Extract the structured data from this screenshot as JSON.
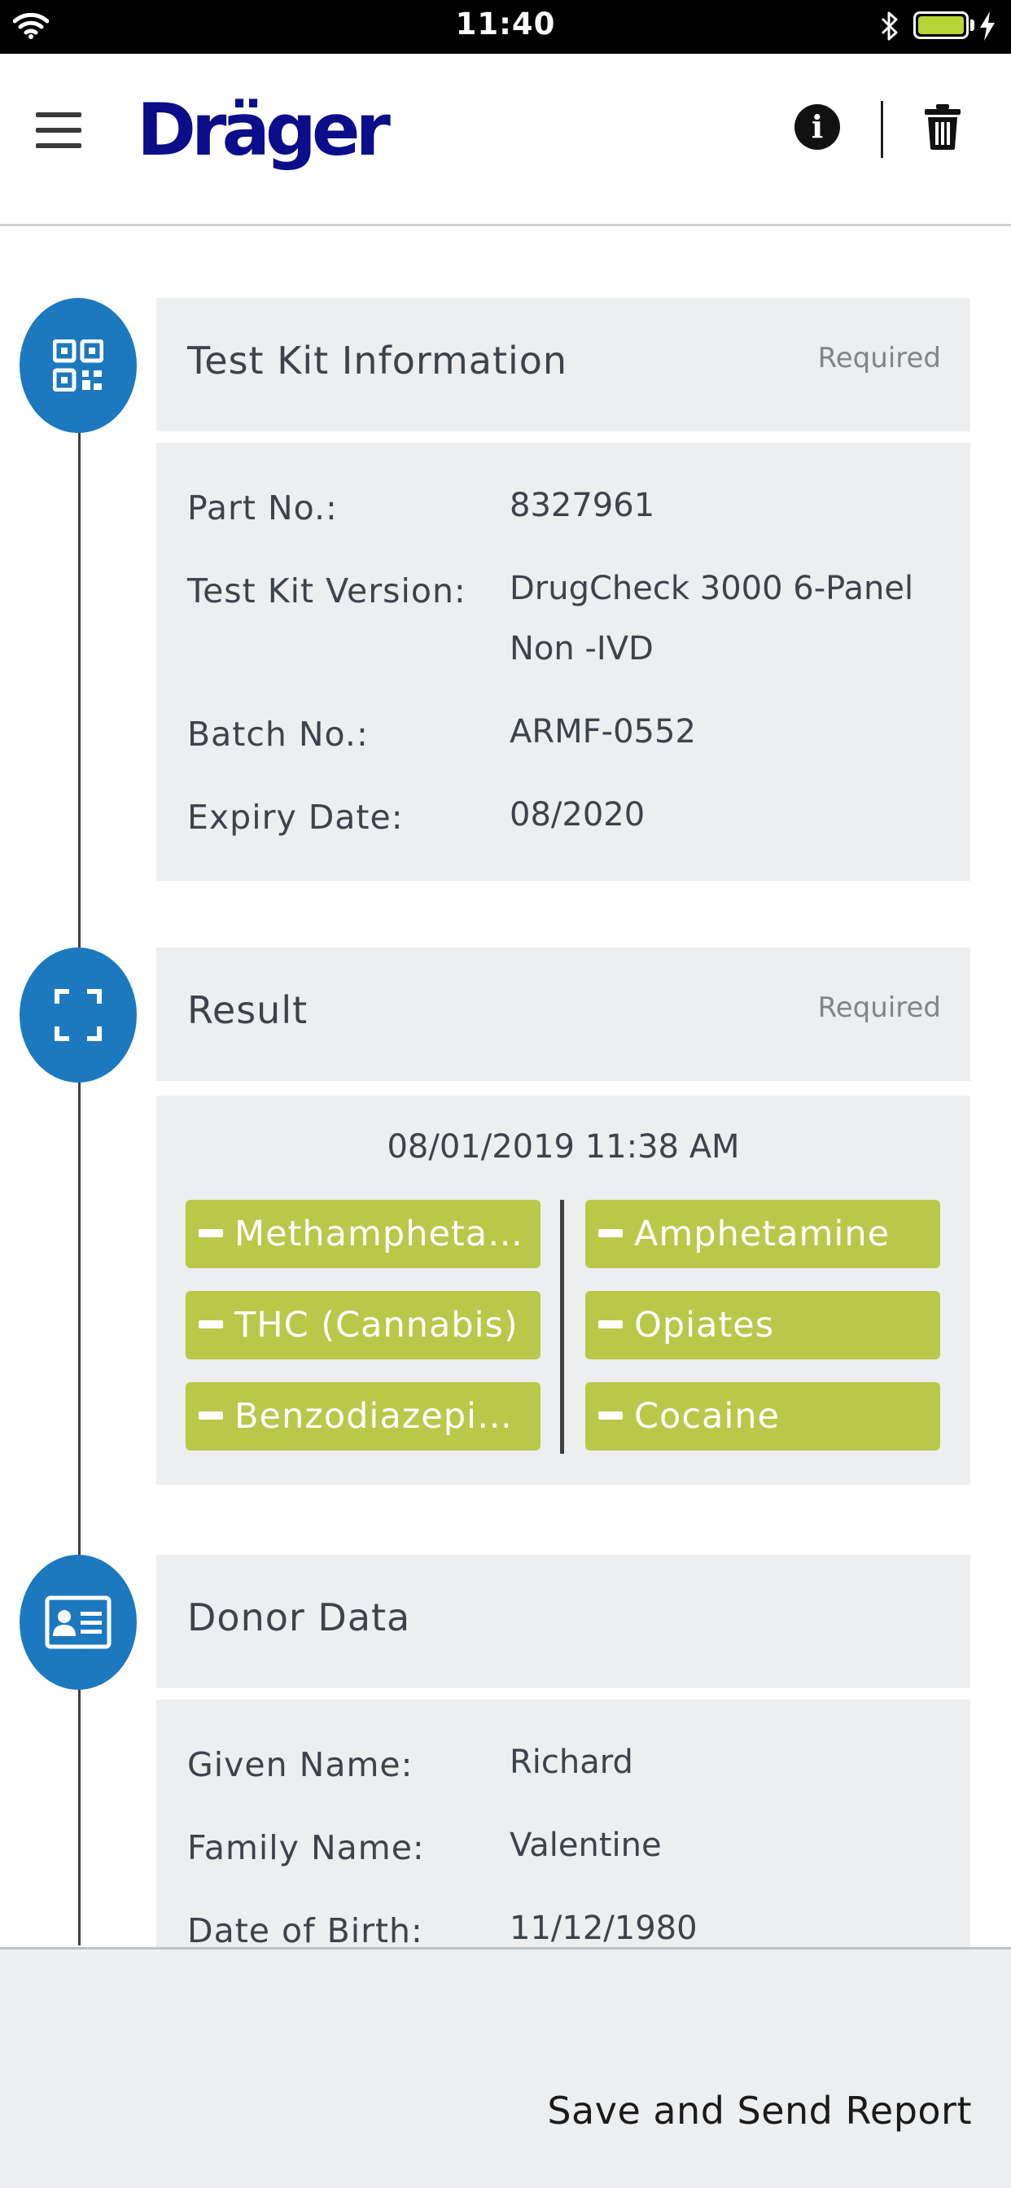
{
  "status_bar": {
    "time": "11:40"
  },
  "header": {
    "logo": "Dräger"
  },
  "test_kit": {
    "title": "Test Kit Information",
    "required": "Required",
    "rows": [
      {
        "label": "Part No.:",
        "value": "8327961"
      },
      {
        "label": "Test Kit Version:",
        "value": "DrugCheck 3000 6-Panel Non -IVD"
      },
      {
        "label": "Batch No.:",
        "value": "ARMF-0552"
      },
      {
        "label": "Expiry Date:",
        "value": "08/2020"
      }
    ]
  },
  "result": {
    "title": "Result",
    "required": "Required",
    "timestamp": "08/01/2019 11:38 AM",
    "substances_left": [
      "Methamphetami...",
      "THC (Cannabis)",
      "Benzodiazepines"
    ],
    "substances_right": [
      "Amphetamine",
      "Opiates",
      "Cocaine"
    ],
    "status": "negative"
  },
  "donor": {
    "title": "Donor Data",
    "rows": [
      {
        "label": "Given Name:",
        "value": "Richard"
      },
      {
        "label": "Family Name:",
        "value": "Valentine"
      },
      {
        "label": "Date of Birth:",
        "value": "11/12/1980"
      }
    ]
  },
  "footer": {
    "button": "Save and Send Report"
  },
  "colors": {
    "brand": "#0b0d8a",
    "accent": "#1c79c0",
    "negative_pill": "#bac84a",
    "battery": "#b7d635"
  }
}
